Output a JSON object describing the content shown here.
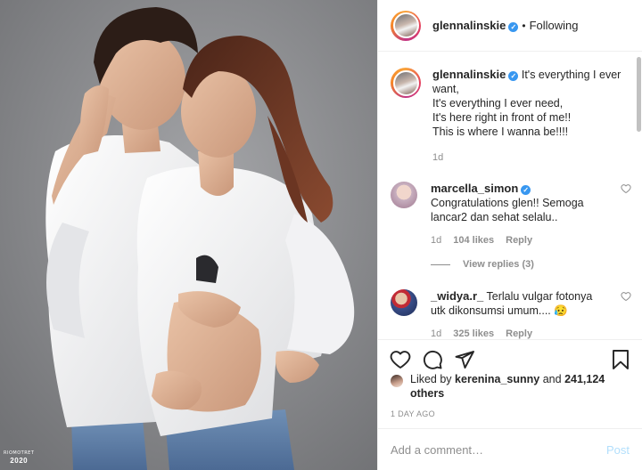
{
  "photo": {
    "watermark_line1": "RIOMOTRET",
    "watermark_line2": "2020",
    "background_color": "#8c8d90"
  },
  "header": {
    "username": "glennalinskie",
    "separator": "•",
    "follow_status": "Following"
  },
  "caption": {
    "username": "glennalinskie",
    "lines": [
      "It's everything I ever want,",
      "It's everything I ever need,",
      "It's here right in front of me!!",
      "This is where I wanna be!!!!"
    ],
    "time": "1d"
  },
  "comments": [
    {
      "username": "marcella_simon",
      "verified": true,
      "text": "Congratulations glen!! Semoga lancar2 dan sehat selalu..",
      "time": "1d",
      "likes": "104 likes",
      "reply": "Reply",
      "avatar_color": "#c8b0c0"
    },
    {
      "username": "_widya.r_",
      "verified": false,
      "text": "Terlalu vulgar fotonya utk dikonsumsi umum....",
      "emoji": "😥",
      "time": "1d",
      "likes": "325 likes",
      "reply": "Reply",
      "avatar_color": "#4a5a8a"
    }
  ],
  "view_replies": "View replies (3)",
  "actions": {
    "icons": [
      "heart-icon",
      "comment-icon",
      "share-icon",
      "bookmark-icon"
    ]
  },
  "likes": {
    "prefix": "Liked by",
    "user": "kerenina_sunny",
    "conj": "and",
    "count": "241,124 others"
  },
  "timestamp": "1 DAY AGO",
  "add_comment": {
    "placeholder": "Add a comment…",
    "post_label": "Post"
  },
  "colors": {
    "verified": "#3897f0",
    "post_disabled": "#b2dffc",
    "muted": "#8e8e8e"
  }
}
